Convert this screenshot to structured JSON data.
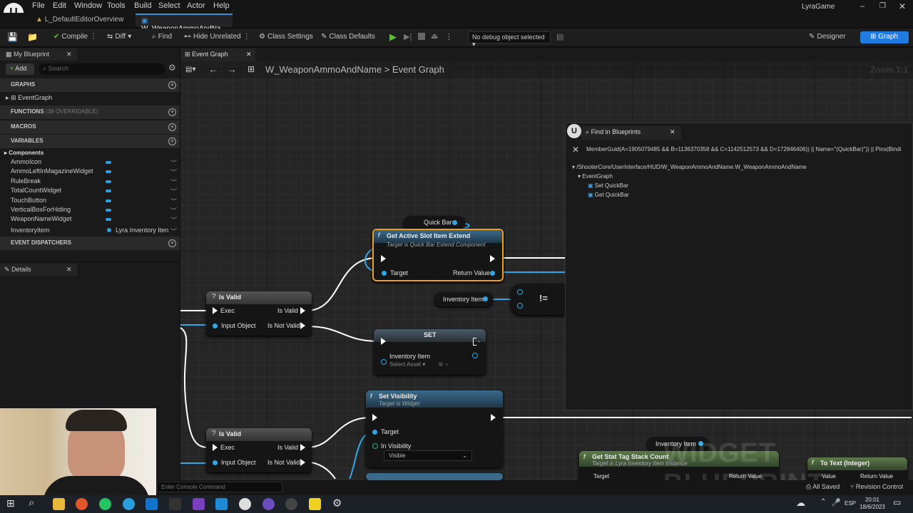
{
  "menu": [
    "File",
    "Edit",
    "Window",
    "Tools",
    "Build",
    "Select",
    "Actor",
    "Help"
  ],
  "project": "LyraGame",
  "tabs": [
    "L_DefaultEditorOverview",
    "W_WeaponAmmoAndNa..."
  ],
  "toolbar": {
    "compile": "Compile",
    "diff": "Diff",
    "find": "Find",
    "hide_unrelated": "Hide Unrelated",
    "class_settings": "Class Settings",
    "class_defaults": "Class Defaults",
    "debug": "No debug object selected",
    "designer": "Designer",
    "graph": "Graph"
  },
  "my_blueprint": {
    "title": "My Blueprint",
    "add": "Add",
    "search_placeholder": "Search",
    "graphs": "GRAPHS",
    "event_graph": "EventGraph",
    "functions": "FUNCTIONS",
    "functions_note": "(38 OVERRIDABLE)",
    "macros": "MACROS",
    "variables": "VARIABLES",
    "components": "Components",
    "vars": [
      "AmmoIcon",
      "AmmoLeftInMagazineWidget",
      "RuleBreak",
      "TotalCountWidget",
      "TouchButton",
      "VerticalBoxForHiding",
      "WeaponNameWidget",
      "InventoryItem"
    ],
    "inventory_type": "Lyra Inventory Iten",
    "event_dispatchers": "EVENT DISPATCHERS"
  },
  "details": {
    "title": "Details"
  },
  "graph_tab": "Event Graph",
  "breadcrumb": {
    "asset": "W_WeaponAmmoAndName",
    "sep": ">",
    "graph": "Event Graph"
  },
  "zoom": "Zoom 1:1",
  "watermark": "WIDGET BLUEPRINT",
  "nodes": {
    "quickbar": "Quick Bar",
    "getactive": {
      "title": "Get Active Slot Item Extend",
      "sub": "Target is Quick Bar Extend Component",
      "target": "Target",
      "ret": "Return Value"
    },
    "isvalid1": {
      "title": "Is Valid",
      "exec": "Exec",
      "valid": "Is Valid",
      "input": "Input Object",
      "notvalid": "Is Not Valid"
    },
    "isvalid2": {
      "title": "Is Valid",
      "exec": "Exec",
      "valid": "Is Valid",
      "input": "Input Object",
      "notvalid": "Is Not Valid"
    },
    "inventory": "Inventory Item",
    "neq": "!=",
    "set": {
      "title": "SET",
      "pin": "Inventory Item",
      "asset": "Select Asset"
    },
    "setvis": {
      "title": "Set Visibility",
      "sub": "Target is Widget",
      "target": "Target",
      "invis": "In Visibility",
      "value": "Visible"
    },
    "inventory2": "Inventory Item",
    "stattag": {
      "title": "Get Stat Tag Stack Count",
      "sub": "Target is Lyra Inventory Item Instance",
      "target": "Target",
      "ret": "Return Value"
    },
    "totext": {
      "title": "To Text (Integer)",
      "value": "Value",
      "ret": "Return Value"
    }
  },
  "find_panel": {
    "title": "Find in Blueprints",
    "query": "MemberGuid(A=1905079485 && B=1136370358 && C=1142512573 && D=172846406)) || Name=\"(QuickBar)\")) || Pins(Bindi",
    "path": "/ShooterCore/UserInterface/HUD/W_WeaponAmmoAndName.W_WeaponAmmoAndName",
    "event_graph": "EventGraph",
    "results": [
      "Set QuickBar",
      "Get QuickBar"
    ]
  },
  "console_placeholder": "Enter Console Command",
  "status": {
    "saved": "All Saved",
    "revision": "Revision Control"
  },
  "taskbar": {
    "lang": "ESP",
    "time": "20:01",
    "date": "18/6/2023"
  }
}
